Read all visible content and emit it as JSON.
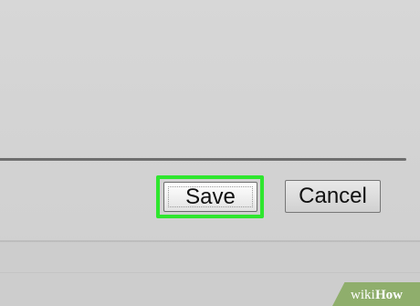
{
  "buttons": {
    "save_label": "Save",
    "cancel_label": "Cancel"
  },
  "colors": {
    "highlight": "#2ee62e",
    "watermark_bg": "#8fae6c"
  },
  "watermark": {
    "text": "wikiHow"
  }
}
